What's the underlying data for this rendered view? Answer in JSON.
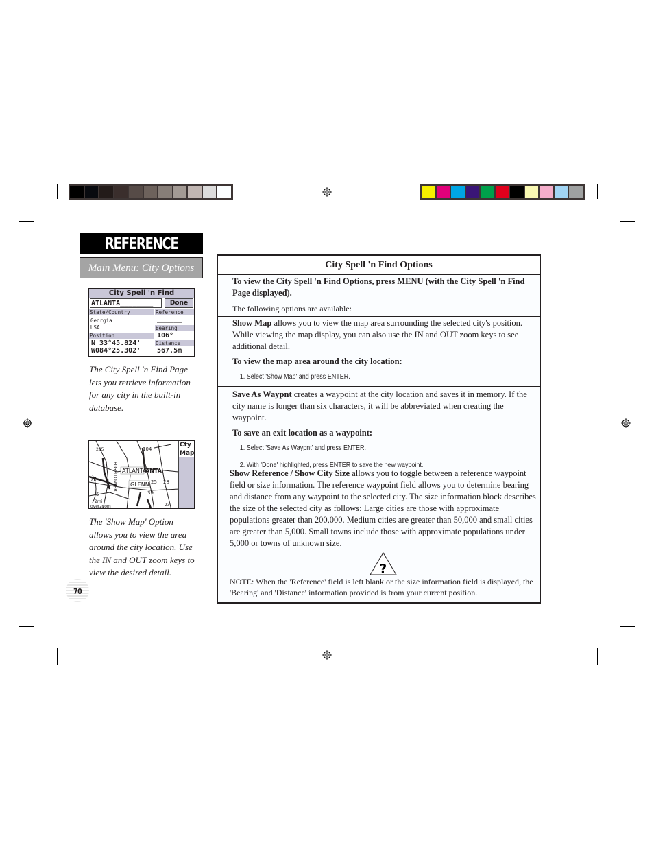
{
  "color_bars": {
    "grayscale": [
      "#000000",
      "#080a0f",
      "#231b19",
      "#3a2e2c",
      "#564b47",
      "#6d625c",
      "#877e78",
      "#a39a94",
      "#c1b6b2",
      "#dcdcdc",
      "#fbfeff"
    ],
    "process": [
      "#f6ef00",
      "#e2007a",
      "#00a6e4",
      "#3a1677",
      "#00a14b",
      "#e0001c",
      "#000000",
      "#f9f8b3",
      "#f5aecb",
      "#a2d5f4",
      "#9fa1a1"
    ]
  },
  "sidebar": {
    "section_title": "REFERENCE",
    "section_tab": "Main Menu: City Options",
    "city_spell_screen": {
      "title": "City Spell 'n Find",
      "name_field": "ATLANTA________",
      "done_button": "Done",
      "state_country_label": "State/Country",
      "state": "Georgia",
      "country": "USA",
      "reference_label": "Reference",
      "reference_value": "______",
      "position_label": "Position",
      "latitude": "N 33°45.824'",
      "longitude": "W084°25.302'",
      "bearing_label": "Bearing",
      "bearing_value": "106°",
      "distance_label": "Distance",
      "distance_value": "567.5m"
    },
    "caption_1": "The City Spell 'n Find Page lets you retrieve information for any city in the built-in database.",
    "map_screen": {
      "labels": [
        "ATLANTA",
        "ANTA",
        "GLENN",
        "HIGHTOWER",
        "285",
        "104",
        "75",
        "25",
        "28",
        "39",
        "5",
        "23",
        "2mi",
        "overzoom"
      ],
      "side_title_1": "Cty",
      "side_title_2": "Map"
    },
    "caption_2": "The 'Show Map' Option allows you to view the area around the city location. Use the IN and OUT zoom keys to view the desired detail.",
    "page_number": "70"
  },
  "options": {
    "title": "City Spell 'n Find Options",
    "intro_instruction": "To view the City Spell 'n Find Options, press MENU (with the City Spell 'n Find Page displayed).",
    "intro_text": "The following options are available:",
    "show_map": {
      "term": "Show Map",
      "description": " allows you to view the map area surrounding the selected city's position. While viewing the map display, you can also use the IN and OUT zoom keys to see additional detail.",
      "procedure_title": "To view the map area around the city location:",
      "steps": [
        "1. Select 'Show Map' and press ENTER."
      ]
    },
    "save_as_waypnt": {
      "term": "Save As Waypnt",
      "description": " creates a waypoint at the city location and saves it in memory. If the city name is longer than six characters, it will be abbreviated when creating the waypoint.",
      "procedure_title": "To save an exit location as a waypoint:",
      "steps": [
        "1. Select 'Save As Waypnt' and press ENTER.",
        "2. With 'Done' highlighted, press ENTER to save the new waypoint."
      ]
    },
    "show_reference": {
      "term": "Show Reference / Show City Size",
      "description": " allows you to toggle between a reference waypoint field or size information. The reference waypoint field allows you to determine bearing and distance from any waypoint to the selected city. The size information block describes the size of the selected city as follows: Large cities are those with approximate populations greater than 200,000. Medium cities are greater than 50,000 and small cities are greater than 5,000. Small towns include those with approximate populations under 5,000 or towns of unknown size.",
      "note_icon": "question-warning-icon",
      "note": "NOTE: When the 'Reference' field is left blank or the size information field is displayed, the 'Bearing' and 'Distance' information provided is from your current position."
    }
  }
}
